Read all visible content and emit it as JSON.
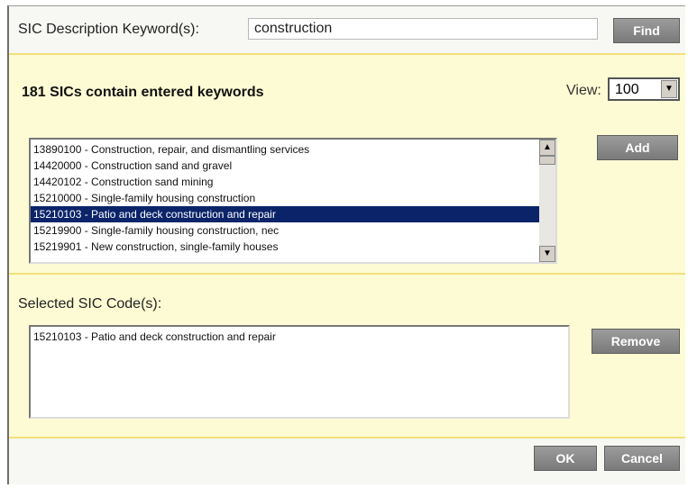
{
  "search": {
    "label": "SIC Description Keyword(s):",
    "value": "construction",
    "find_label": "Find"
  },
  "results": {
    "count_text": "181 SICs contain entered keywords",
    "view_label": "View:",
    "view_value": "100",
    "add_label": "Add",
    "items": [
      "13890100 - Construction, repair, and dismantling services",
      "14420000 - Construction sand and gravel",
      "14420102 - Construction sand mining",
      "15210000 - Single-family housing construction",
      "15210103 - Patio and deck construction and repair",
      "15219900 - Single-family housing construction, nec",
      "15219901 - New construction, single-family houses"
    ],
    "selected_index": 4
  },
  "selected": {
    "label": "Selected SIC Code(s):",
    "items": [
      "15210103 - Patio and deck construction and repair"
    ],
    "remove_label": "Remove"
  },
  "footer": {
    "ok_label": "OK",
    "cancel_label": "Cancel"
  },
  "colors": {
    "panel_yellow": "#fdfbd4",
    "divider_yellow": "#f2e07a",
    "selection_blue": "#0b2469",
    "button_gray": "#8a8a8a"
  }
}
